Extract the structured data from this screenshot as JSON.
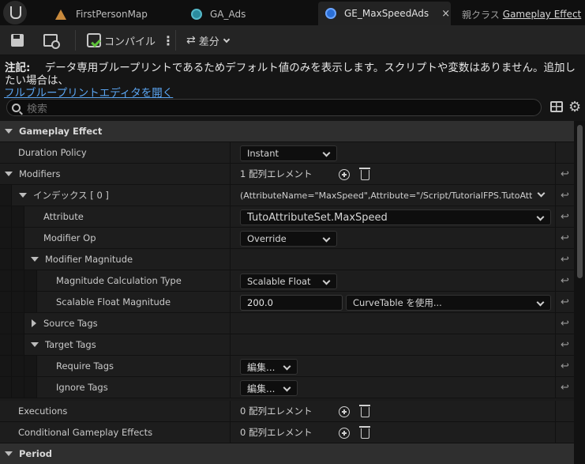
{
  "tabs": [
    {
      "label": "FirstPersonMap",
      "icon": "level-icon"
    },
    {
      "label": "GA_Ads",
      "icon": "blueprint-icon"
    },
    {
      "label": "GE_MaxSpeedAds",
      "icon": "blueprint-icon",
      "active": true,
      "close": "×"
    }
  ],
  "parent_class": {
    "prefix": "親クラス",
    "link": "Gameplay Effect"
  },
  "toolbar": {
    "compile_label": "コンパイル",
    "diff_label": "差分",
    "kebab": "⋮",
    "diff_icon": "⇄"
  },
  "note": {
    "prefix": "注記:",
    "text": "データ専用ブループリントであるためデフォルト値のみを表示します。スクリプトや変数はありません。追加したい場合は、",
    "link": "フルブループリントエディタを開く"
  },
  "search": {
    "placeholder": "検索"
  },
  "gear_glyph": "⚙",
  "reset_glyph": "↩",
  "details": {
    "category_gameplay_effect": "Gameplay Effect",
    "duration_policy": {
      "label": "Duration Policy",
      "value": "Instant"
    },
    "modifiers": {
      "label": "Modifiers",
      "count": "1 配列エレメント"
    },
    "index0": {
      "label": "インデックス [ 0 ]",
      "value": "(AttributeName=\"MaxSpeed\",Attribute=\"/Script/TutorialFPS.TutoAttribu"
    },
    "attribute": {
      "label": "Attribute",
      "value": "TutoAttributeSet.MaxSpeed"
    },
    "modifier_op": {
      "label": "Modifier Op",
      "value": "Override"
    },
    "modifier_magnitude": {
      "label": "Modifier Magnitude"
    },
    "magnitude_calc_type": {
      "label": "Magnitude Calculation Type",
      "value": "Scalable Float"
    },
    "scalable_float_magnitude": {
      "label": "Scalable Float Magnitude",
      "value": "200.0",
      "curve": "CurveTable を使用..."
    },
    "source_tags": {
      "label": "Source Tags"
    },
    "target_tags": {
      "label": "Target Tags"
    },
    "require_tags": {
      "label": "Require Tags",
      "value": "編集..."
    },
    "ignore_tags": {
      "label": "Ignore Tags",
      "value": "編集..."
    },
    "executions": {
      "label": "Executions",
      "count": "0 配列エレメント"
    },
    "conditional_effects": {
      "label": "Conditional Gameplay Effects",
      "count": "0 配列エレメント"
    },
    "category_period": "Period"
  }
}
